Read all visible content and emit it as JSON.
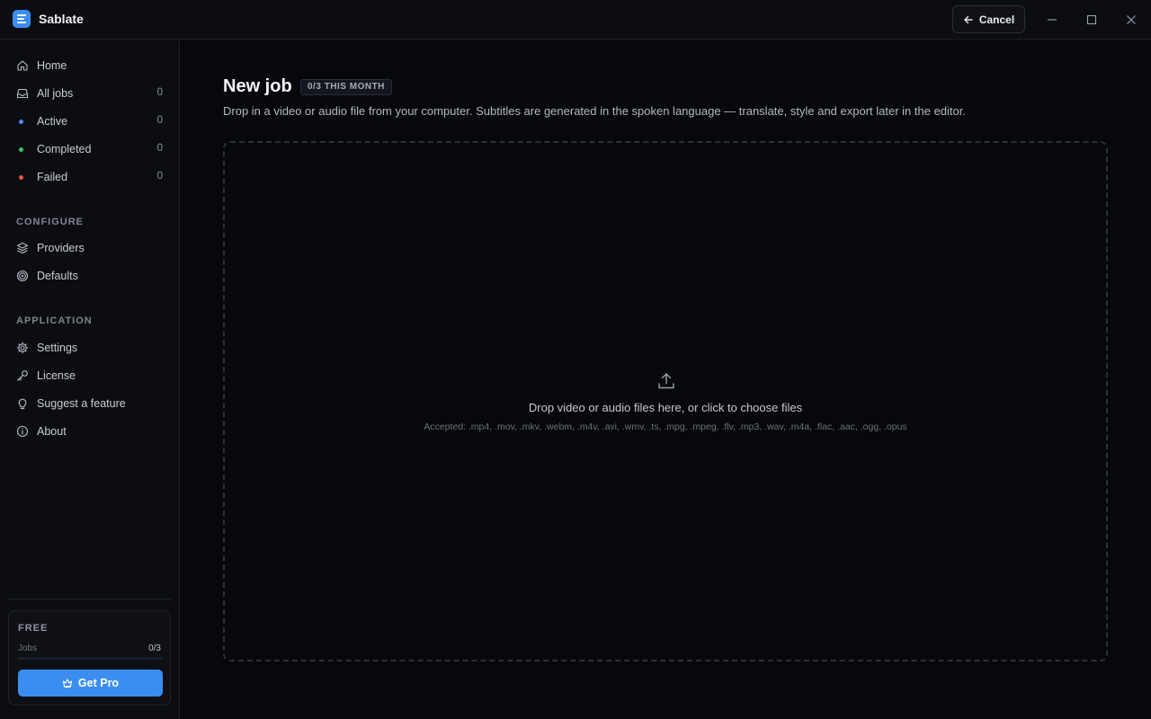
{
  "app": {
    "title": "Sablate",
    "accent": "#3b8ef0"
  },
  "titlebar": {
    "cancel_label": "Cancel",
    "window_controls": [
      "minimize-icon",
      "maximize-icon",
      "close-icon"
    ]
  },
  "sidebar": {
    "items": [
      {
        "label": "Home",
        "icon": "home-icon"
      },
      {
        "label": "All jobs",
        "icon": "inbox-icon",
        "count": "0"
      },
      {
        "label": "Active",
        "dot_color": "#4f8df5",
        "count": "0"
      },
      {
        "label": "Completed",
        "dot_color": "#3ec46d",
        "count": "0"
      },
      {
        "label": "Failed",
        "dot_color": "#ef5350",
        "count": "0"
      }
    ],
    "sections": [
      {
        "title": "CONFIGURE",
        "items": [
          {
            "label": "Providers",
            "icon": "layers-icon"
          },
          {
            "label": "Defaults",
            "icon": "target-icon"
          }
        ]
      },
      {
        "title": "APPLICATION",
        "items": [
          {
            "label": "Settings",
            "icon": "gear-icon"
          },
          {
            "label": "License",
            "icon": "key-icon"
          },
          {
            "label": "Suggest a feature",
            "icon": "lightbulb-icon"
          },
          {
            "label": "About",
            "icon": "info-icon"
          }
        ]
      }
    ],
    "plan": {
      "name": "FREE",
      "jobs_label": "Jobs",
      "jobs_value": "0/3",
      "jobs_used_fraction": 0,
      "get_pro_label": "Get Pro"
    }
  },
  "main": {
    "title": "New job",
    "quota_badge": "0/3 THIS MONTH",
    "description": "Drop in a video or audio file from your computer. Subtitles are generated in the spoken language — translate, style and export later in the editor.",
    "dropzone": {
      "prompt": "Drop video or audio files here, or click to choose files",
      "accepted": "Accepted: .mp4, .mov, .mkv, .webm, .m4v, .avi, .wmv, .ts, .mpg, .mpeg, .flv, .mp3, .wav, .m4a, .flac, .aac, .ogg, .opus"
    }
  }
}
